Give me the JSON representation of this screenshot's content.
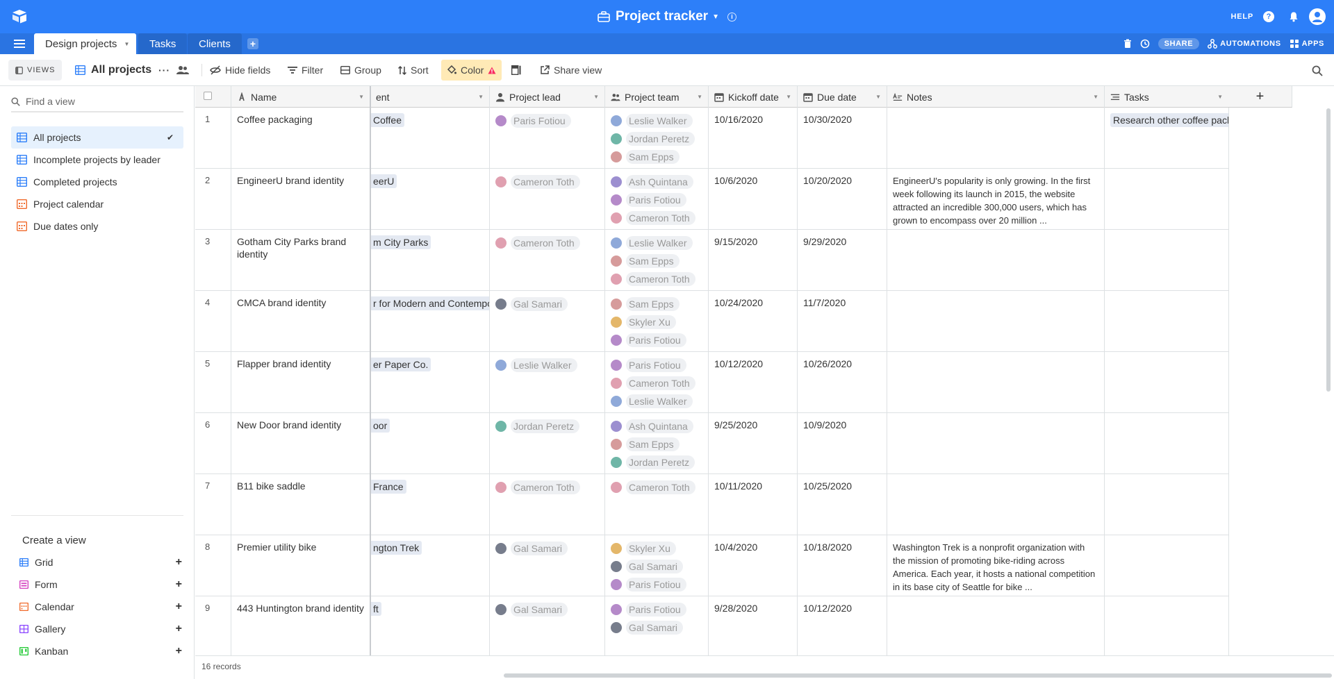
{
  "topbar": {
    "title": "Project tracker",
    "help_label": "HELP"
  },
  "tabs": [
    {
      "label": "Design projects"
    },
    {
      "label": "Tasks"
    },
    {
      "label": "Clients"
    }
  ],
  "tabbar_right": {
    "share_label": "SHARE",
    "automations_label": "AUTOMATIONS",
    "apps_label": "APPS"
  },
  "viewbar": {
    "views_label": "VIEWS",
    "current_view": "All projects",
    "hide_fields": "Hide fields",
    "filter": "Filter",
    "group": "Group",
    "sort": "Sort",
    "color": "Color",
    "share_view": "Share view"
  },
  "sidebar": {
    "find_placeholder": "Find a view",
    "views": [
      {
        "label": "All projects",
        "type": "grid",
        "active": true
      },
      {
        "label": "Incomplete projects by leader",
        "type": "grid"
      },
      {
        "label": "Completed projects",
        "type": "grid"
      },
      {
        "label": "Project calendar",
        "type": "calendar"
      },
      {
        "label": "Due dates only",
        "type": "calendar"
      }
    ],
    "create_title": "Create a view",
    "create_items": [
      {
        "label": "Grid",
        "color": "#2d7ff9"
      },
      {
        "label": "Form",
        "color": "#d43fbf"
      },
      {
        "label": "Calendar",
        "color": "#f06a2b"
      },
      {
        "label": "Gallery",
        "color": "#8b46ff"
      },
      {
        "label": "Kanban",
        "color": "#20c933"
      }
    ]
  },
  "columns": {
    "name": "Name",
    "client": "ent",
    "lead": "Project lead",
    "team": "Project team",
    "kickoff": "Kickoff date",
    "due": "Due date",
    "notes": "Notes",
    "tasks": "Tasks"
  },
  "rows": [
    {
      "num": "1",
      "name": "Coffee packaging",
      "client": "Coffee",
      "lead": "Paris Fotiou",
      "team": [
        "Leslie Walker",
        "Jordan Peretz",
        "Sam Epps"
      ],
      "kickoff": "10/16/2020",
      "due": "10/30/2020",
      "notes": "",
      "tasks": "Research other coffee pack"
    },
    {
      "num": "2",
      "name": "EngineerU brand identity",
      "client": "eerU",
      "lead": "Cameron Toth",
      "team": [
        "Ash Quintana",
        "Paris Fotiou",
        "Cameron Toth"
      ],
      "kickoff": "10/6/2020",
      "due": "10/20/2020",
      "notes": "EngineerU's popularity is only growing. In the first week following its launch in 2015, the website attracted an incredible 300,000 users, which has grown to encompass over 20 million ...",
      "tasks": ""
    },
    {
      "num": "3",
      "name": "Gotham City Parks brand identity",
      "client": "m City Parks",
      "lead": "Cameron Toth",
      "team": [
        "Leslie Walker",
        "Sam Epps",
        "Cameron Toth"
      ],
      "kickoff": "9/15/2020",
      "due": "9/29/2020",
      "notes": "",
      "tasks": ""
    },
    {
      "num": "4",
      "name": "CMCA brand identity",
      "client": "r for Modern and Contempo",
      "lead": "Gal Samari",
      "team": [
        "Sam Epps",
        "Skyler Xu",
        "Paris Fotiou"
      ],
      "kickoff": "10/24/2020",
      "due": "11/7/2020",
      "notes": "",
      "tasks": ""
    },
    {
      "num": "5",
      "name": "Flapper brand identity",
      "client": "er Paper Co.",
      "lead": "Leslie Walker",
      "team": [
        "Paris Fotiou",
        "Cameron Toth",
        "Leslie Walker"
      ],
      "kickoff": "10/12/2020",
      "due": "10/26/2020",
      "notes": "",
      "tasks": ""
    },
    {
      "num": "6",
      "name": "New Door brand identity",
      "client": "oor",
      "lead": "Jordan Peretz",
      "team": [
        "Ash Quintana",
        "Sam Epps",
        "Jordan Peretz"
      ],
      "kickoff": "9/25/2020",
      "due": "10/9/2020",
      "notes": "",
      "tasks": ""
    },
    {
      "num": "7",
      "name": "B11 bike saddle",
      "client": "France",
      "lead": "Cameron Toth",
      "team": [
        "Cameron Toth"
      ],
      "kickoff": "10/11/2020",
      "due": "10/25/2020",
      "notes": "",
      "tasks": ""
    },
    {
      "num": "8",
      "name": "Premier utility bike",
      "client": "ngton Trek",
      "lead": "Gal Samari",
      "team": [
        "Skyler Xu",
        "Gal Samari",
        "Paris Fotiou"
      ],
      "kickoff": "10/4/2020",
      "due": "10/18/2020",
      "notes": "Washington Trek is a nonprofit organization with the mission of promoting bike-riding across America. Each year, it hosts a national competition in its base city of Seattle for bike ...",
      "tasks": ""
    },
    {
      "num": "9",
      "name": "443 Huntington brand identity",
      "client": "ft",
      "lead": "Gal Samari",
      "team": [
        "Paris Fotiou",
        "Gal Samari"
      ],
      "kickoff": "9/28/2020",
      "due": "10/12/2020",
      "notes": "",
      "tasks": ""
    }
  ],
  "footer": {
    "record_count": "16 records"
  },
  "colors": {
    "brand": "#2d7ff9",
    "tabbar": "#2a74e2",
    "pill": "#e4e9f2",
    "active_view": "#e6f1fd",
    "color_button": "#ffeab6"
  },
  "avatar_colors": {
    "Leslie Walker": "#8fa9d9",
    "Jordan Peretz": "#6fb6a7",
    "Sam Epps": "#d69b9b",
    "Paris Fotiou": "#b58ac9",
    "Cameron Toth": "#e0a0b0",
    "Ash Quintana": "#9c8fd0",
    "Gal Samari": "#777d8c",
    "Skyler Xu": "#e4b76a"
  }
}
